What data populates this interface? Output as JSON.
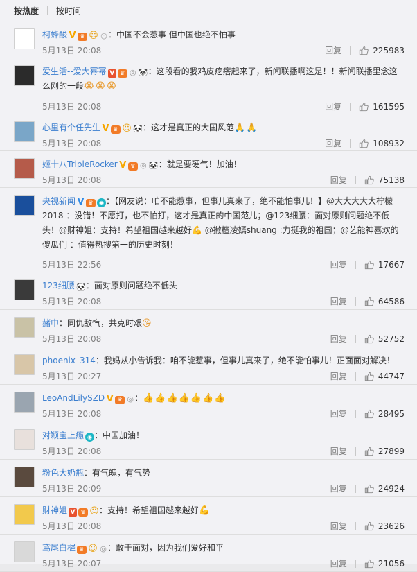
{
  "tabs": [
    "按热度",
    "按时间"
  ],
  "reply_label": "回复",
  "comments": [
    {
      "user": "柯蜂酸",
      "badges": [
        "v-gold",
        "crown",
        "smile",
        "medal"
      ],
      "text": "：中国不会惹事 但中国也绝不怕事",
      "emoji": "",
      "time": "5月13日 20:08",
      "likes": "225983",
      "avatar_color": "#ffffff",
      "avatar_fg": "#444"
    },
    {
      "user": "爱生活--爱大幂幂",
      "badges": [
        "v-red",
        "crown",
        "medal",
        "panda"
      ],
      "text": "：这段看的我鸡皮疙瘩起来了，新闻联播啊这是！！新闻联播里念这么刚的一段",
      "emoji": "😭😭😭",
      "time": "5月13日 20:08",
      "likes": "161595",
      "avatar_color": "#2b2b2b",
      "avatar_fg": "#ccc"
    },
    {
      "user": "心里有个任先生",
      "badges": [
        "v-gold",
        "crown",
        "smile",
        "panda"
      ],
      "text": "：这才是真正的大国风范",
      "emoji": "🙏🙏",
      "time": "5月13日 20:08",
      "likes": "108932",
      "avatar_color": "#7aa6c8",
      "avatar_fg": "#fff"
    },
    {
      "user": "姬十八TripleRocker",
      "badges": [
        "v-gold",
        "crown",
        "medal",
        "panda"
      ],
      "text": "：就是要硬气！加油！",
      "emoji": "",
      "time": "5月13日 20:08",
      "likes": "75138",
      "avatar_color": "#b55b4a",
      "avatar_fg": "#fff"
    },
    {
      "user": "央视新闻",
      "badges": [
        "v-blue",
        "crown",
        "eye"
      ],
      "text": "：【网友说：咱不能惹事，但事儿真来了，绝不能怕事儿！】@大大大大大柠檬2018 ：没错！不愿打，也不怕打，这才是真正的中国范儿；@123细腰：面对原则问题绝不低头！@财神姐：支持！希望祖国越来越好💪 @撒檀凌嫣shuang :力挺我的祖国；@艺能神喜欢的傻瓜们 ：值得热搜第一的历史时刻！",
      "emoji": "",
      "time": "5月13日 22:56",
      "likes": "17667",
      "avatar_color": "#1a4f9c",
      "avatar_fg": "#fff"
    },
    {
      "user": "123细腰",
      "badges": [
        "panda"
      ],
      "text": "：面对原则问题绝不低头",
      "emoji": "",
      "time": "5月13日 20:08",
      "likes": "64586",
      "avatar_color": "#3a3a3a",
      "avatar_fg": "#ddd"
    },
    {
      "user": "赭申",
      "badges": [],
      "text": "：同仇敌忾，共克时艰",
      "emoji": "😘",
      "time": "5月13日 20:08",
      "likes": "52752",
      "avatar_color": "#c9c2a6",
      "avatar_fg": "#555"
    },
    {
      "user": "phoenix_314",
      "badges": [],
      "text": "：我妈从小告诉我：咱不能惹事，但事儿真来了，绝不能怕事儿！正面面对解决！",
      "emoji": "",
      "time": "5月13日 20:27",
      "likes": "44747",
      "avatar_color": "#d8c6a8",
      "avatar_fg": "#555"
    },
    {
      "user": "LeoAndLilySZD",
      "badges": [
        "v-gold",
        "crown",
        "medal"
      ],
      "text": "：",
      "emoji": "👍👍👍👍👍👍👍",
      "time": "5月13日 20:08",
      "likes": "28495",
      "avatar_color": "#9aa5b0",
      "avatar_fg": "#fff"
    },
    {
      "user": "对颖宝上瘾",
      "badges": [
        "eye"
      ],
      "text": "：中国加油！",
      "emoji": "",
      "time": "5月13日 20:08",
      "likes": "27899",
      "avatar_color": "#e8e0dc",
      "avatar_fg": "#666"
    },
    {
      "user": "粉色大奶瓶",
      "badges": [],
      "text": "：有气魄，有气势",
      "emoji": "",
      "time": "5月13日 20:09",
      "likes": "24924",
      "avatar_color": "#5a4a3e",
      "avatar_fg": "#eee"
    },
    {
      "user": "财神姐",
      "badges": [
        "v-red",
        "crown",
        "smile"
      ],
      "text": "：支持！希望祖国越来越好",
      "emoji": "💪",
      "time": "5月13日 20:08",
      "likes": "23626",
      "avatar_color": "#f2c94c",
      "avatar_fg": "#8a4b00"
    },
    {
      "user": "鸢尾白樨",
      "badges": [
        "crown",
        "smile",
        "medal"
      ],
      "text": "：敢于面对，因为我们爱好和平",
      "emoji": "",
      "time": "5月13日 20:07",
      "likes": "21056",
      "avatar_color": "#d9d9d9",
      "avatar_fg": "#444"
    }
  ]
}
